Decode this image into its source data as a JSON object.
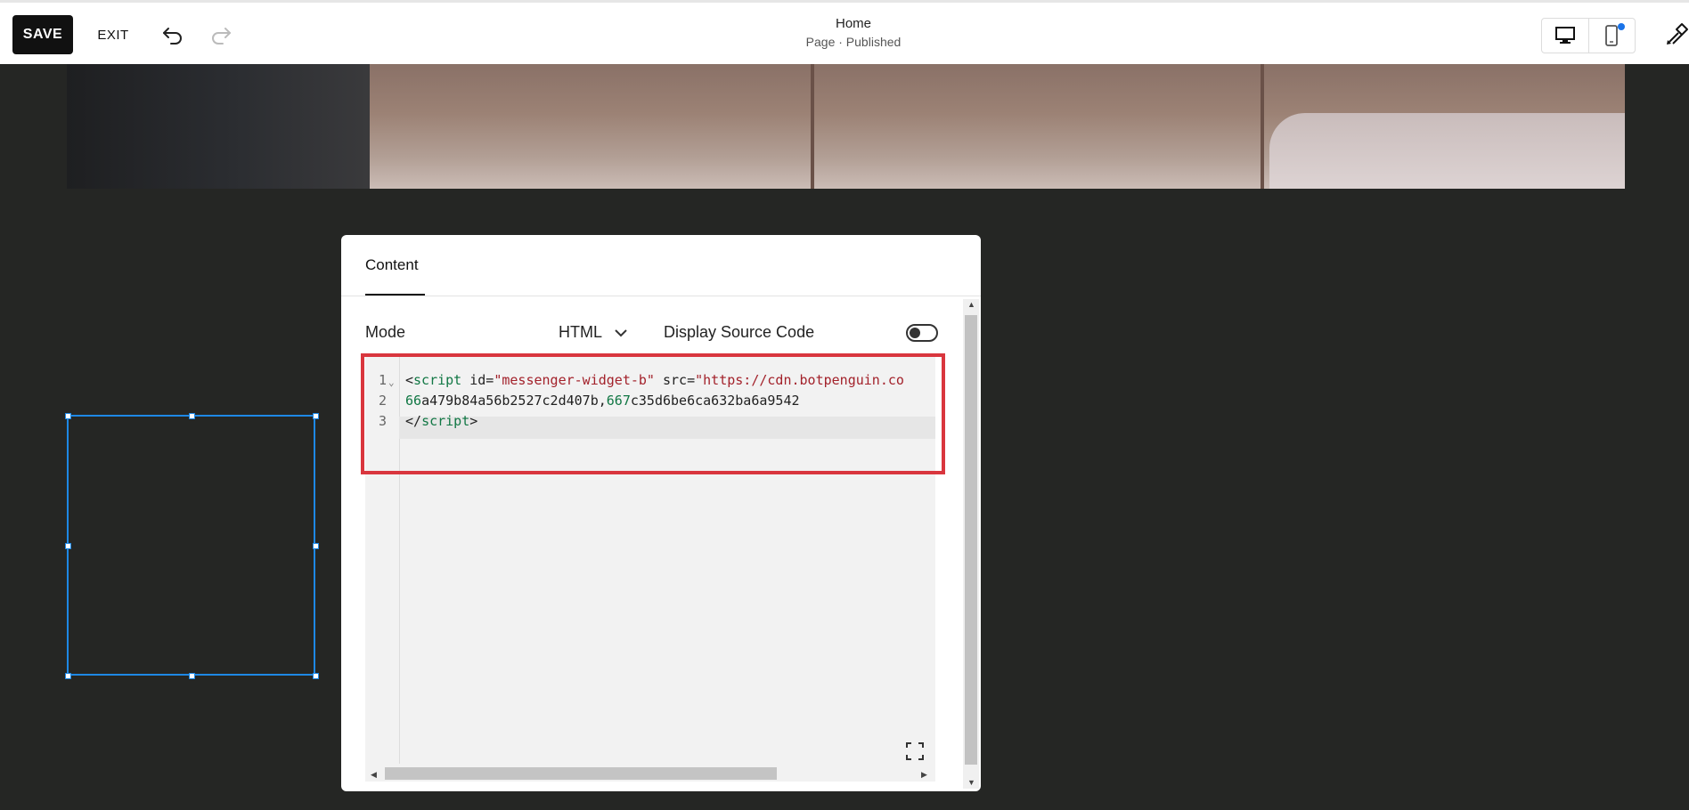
{
  "toolbar": {
    "save_label": "SAVE",
    "exit_label": "EXIT",
    "page_title": "Home",
    "page_status": "Page · Published",
    "icons": [
      "undo-icon",
      "redo-icon",
      "desktop-icon",
      "mobile-icon",
      "design-brush-icon"
    ],
    "accent_color": "#1a73e8"
  },
  "panel": {
    "tab_label": "Content",
    "mode_label": "Mode",
    "mode_value": "HTML",
    "source_label": "Display Source Code",
    "source_toggle_on": false
  },
  "editor": {
    "line_numbers": [
      "1",
      "2",
      "3"
    ],
    "lines": [
      [
        {
          "t": "<",
          "c": "attr"
        },
        {
          "t": "script",
          "c": "tag"
        },
        {
          "t": " id=",
          "c": "attr"
        },
        {
          "t": "\"messenger-widget-b\"",
          "c": "str"
        },
        {
          "t": " src=",
          "c": "attr"
        },
        {
          "t": "\"https://cdn.botpenguin.co",
          "c": "str"
        }
      ],
      [
        {
          "t": "66",
          "c": "num"
        },
        {
          "t": "a479b84a56b2527c2d407b,",
          "c": "attr"
        },
        {
          "t": "667",
          "c": "num"
        },
        {
          "t": "c35d6be6ca632ba6a9542",
          "c": "attr"
        }
      ],
      [
        {
          "t": "</",
          "c": "attr"
        },
        {
          "t": "script",
          "c": "tag"
        },
        {
          "t": ">",
          "c": "attr"
        }
      ]
    ],
    "highlight_color": "#d9363e"
  }
}
